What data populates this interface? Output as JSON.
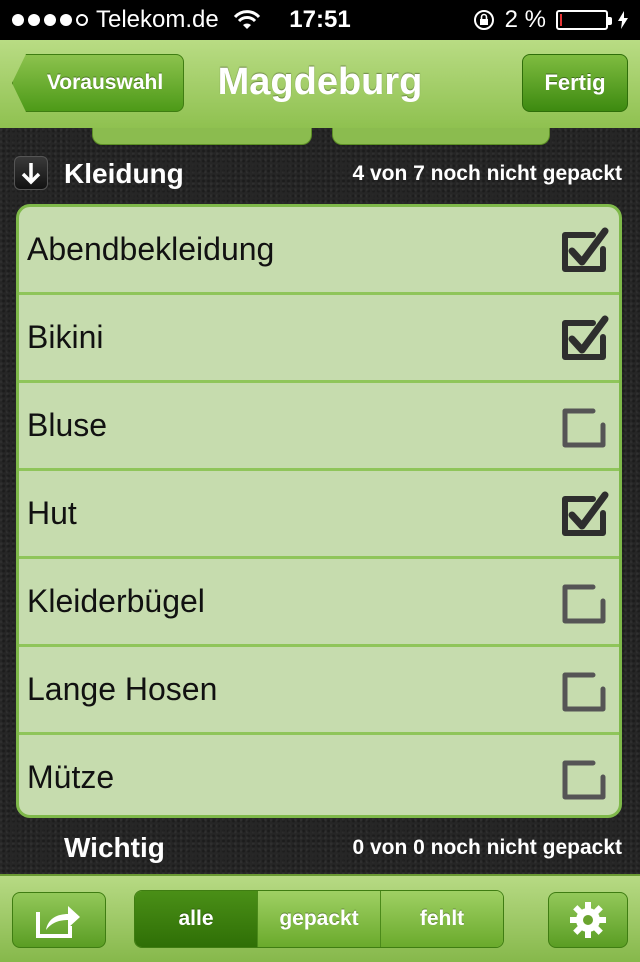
{
  "status_bar": {
    "carrier": "Telekom.de",
    "time": "17:51",
    "battery": "2 %"
  },
  "nav": {
    "back_label": "Vorauswahl",
    "title": "Magdeburg",
    "done_label": "Fertig"
  },
  "section_clothing": {
    "title": "Kleidung",
    "count": "4 von 7 noch nicht gepackt",
    "items": [
      {
        "label": "Abendbekleidung",
        "checked": true
      },
      {
        "label": "Bikini",
        "checked": true
      },
      {
        "label": "Bluse",
        "checked": false
      },
      {
        "label": "Hut",
        "checked": true
      },
      {
        "label": "Kleiderbügel",
        "checked": false
      },
      {
        "label": "Lange Hosen",
        "checked": false
      },
      {
        "label": "Mütze",
        "checked": false
      }
    ]
  },
  "section_important": {
    "title": "Wichtig",
    "count": "0 von 0 noch nicht gepackt"
  },
  "toolbar": {
    "filters": [
      "alle",
      "gepackt",
      "fehlt"
    ],
    "active_filter": "alle",
    "share_icon": "share-icon",
    "settings_icon": "gear-icon"
  },
  "colors": {
    "accent_green": "#5a9d23",
    "list_bg": "#c6dcae"
  }
}
